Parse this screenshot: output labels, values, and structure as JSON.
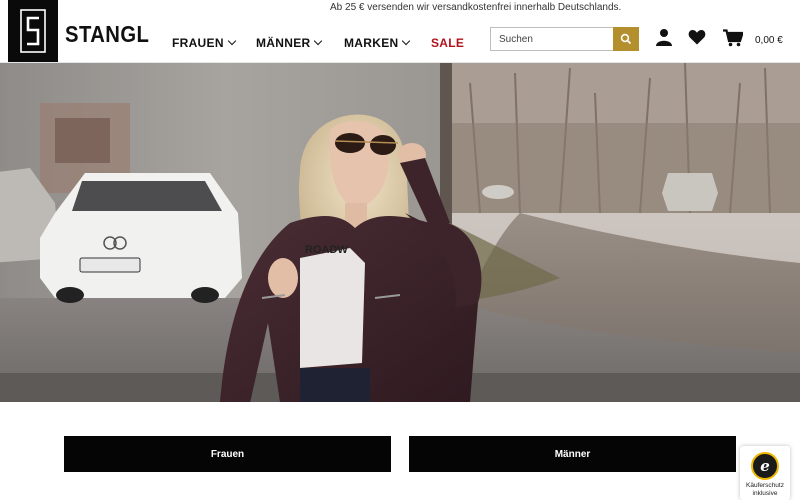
{
  "brand": {
    "name": "STANGL",
    "logo_mark": "S"
  },
  "top_bar": {
    "shipping_note": "Ab 25 € versenden wir versandkostenfrei innerhalb Deutschlands."
  },
  "nav": {
    "items": [
      {
        "label": "FRAUEN",
        "has_dropdown": true
      },
      {
        "label": "MÄNNER",
        "has_dropdown": true
      },
      {
        "label": "MARKEN",
        "has_dropdown": true
      },
      {
        "label": "SALE",
        "has_dropdown": false,
        "color": "#b3121d"
      }
    ]
  },
  "search": {
    "placeholder": "Suchen",
    "value": "",
    "button_color": "#b38f2e",
    "icon": "search-icon"
  },
  "header_icons": [
    {
      "name": "account-icon"
    },
    {
      "name": "heart-icon"
    },
    {
      "name": "cart-icon"
    }
  ],
  "cart": {
    "total": "0,00 €"
  },
  "hero": {
    "shirt_text": "ROADW"
  },
  "categories": [
    {
      "label": "Frauen"
    },
    {
      "label": "Männer"
    }
  ],
  "trust_badge": {
    "logo": "e",
    "line1": "Käuferschutz",
    "line2": "inklusive",
    "accent": "#f0b700"
  }
}
